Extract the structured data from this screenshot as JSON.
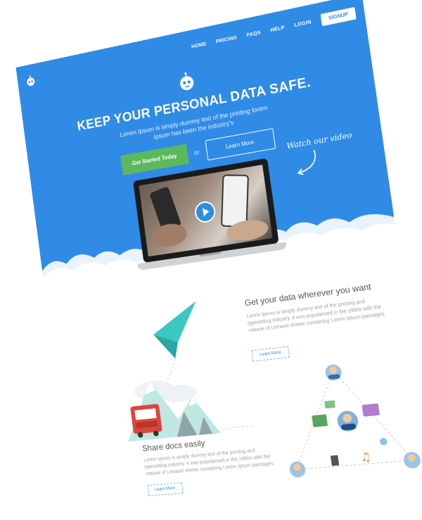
{
  "nav": {
    "items": [
      "HOME",
      "PRICING",
      "FAQS",
      "HELP",
      "LOGIN"
    ],
    "signup": "SIGNUP"
  },
  "hero": {
    "headline": "KEEP YOUR PERSONAL DATA SAFE.",
    "subtext": "Lorem Ipsum is simply dummy text of the printing lorem Ipsum has been the industry's",
    "primary_cta": "Get Started Today",
    "or_text": "or",
    "secondary_cta": "Learn More",
    "watch_video": "Watch our video"
  },
  "feature_1": {
    "title": "Get your data wherever you want",
    "text": "Lorem Ipsum is simply dummy text of the printing and typesetting industry. It was popularised in the 1960s with the release of Letraset sheets containing Lorem Ipsum passages.",
    "button": "Learn More"
  },
  "feature_2": {
    "title": "Share docs easily",
    "text": "Lorem Ipsum is simply dummy text of the printing and typesetting industry. It was popularised in the 1960s with the release of Letraset sheets containing Lorem Ipsum passages.",
    "button": "Learn More"
  },
  "colors": {
    "hero_blue": "#2f8be6",
    "cta_green": "#5cb85c",
    "paper_plane": "#3cc7c1"
  }
}
